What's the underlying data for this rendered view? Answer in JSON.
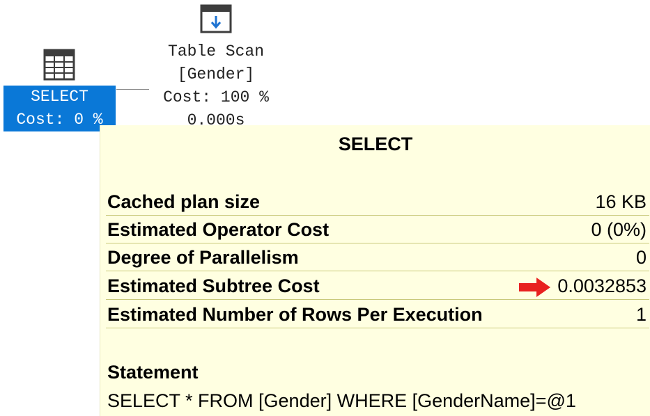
{
  "plan": {
    "table_scan": {
      "icon": "table-scan-icon",
      "line1": "Table Scan",
      "line2": "[Gender]",
      "line3": "Cost: 100 %",
      "line4": "0.000s"
    },
    "select": {
      "icon": "select-grid-icon",
      "line1": "SELECT",
      "line2": "Cost: 0 %"
    }
  },
  "tooltip": {
    "title": "SELECT",
    "properties": [
      {
        "name": "Cached plan size",
        "value": "16 KB"
      },
      {
        "name": "Estimated Operator Cost",
        "value": "0 (0%)"
      },
      {
        "name": "Degree of Parallelism",
        "value": "0"
      },
      {
        "name": "Estimated Subtree Cost",
        "value": "0.0032853",
        "marker": "red-arrow-icon"
      },
      {
        "name": "Estimated Number of Rows Per Execution",
        "value": "1"
      }
    ],
    "statement_label": "Statement",
    "statement": "SELECT * FROM [Gender] WHERE [GenderName]=@1"
  },
  "colors": {
    "selected_node_bg": "#0a78d7",
    "tooltip_bg": "#ffffe1",
    "arrow": "#e8211f"
  }
}
